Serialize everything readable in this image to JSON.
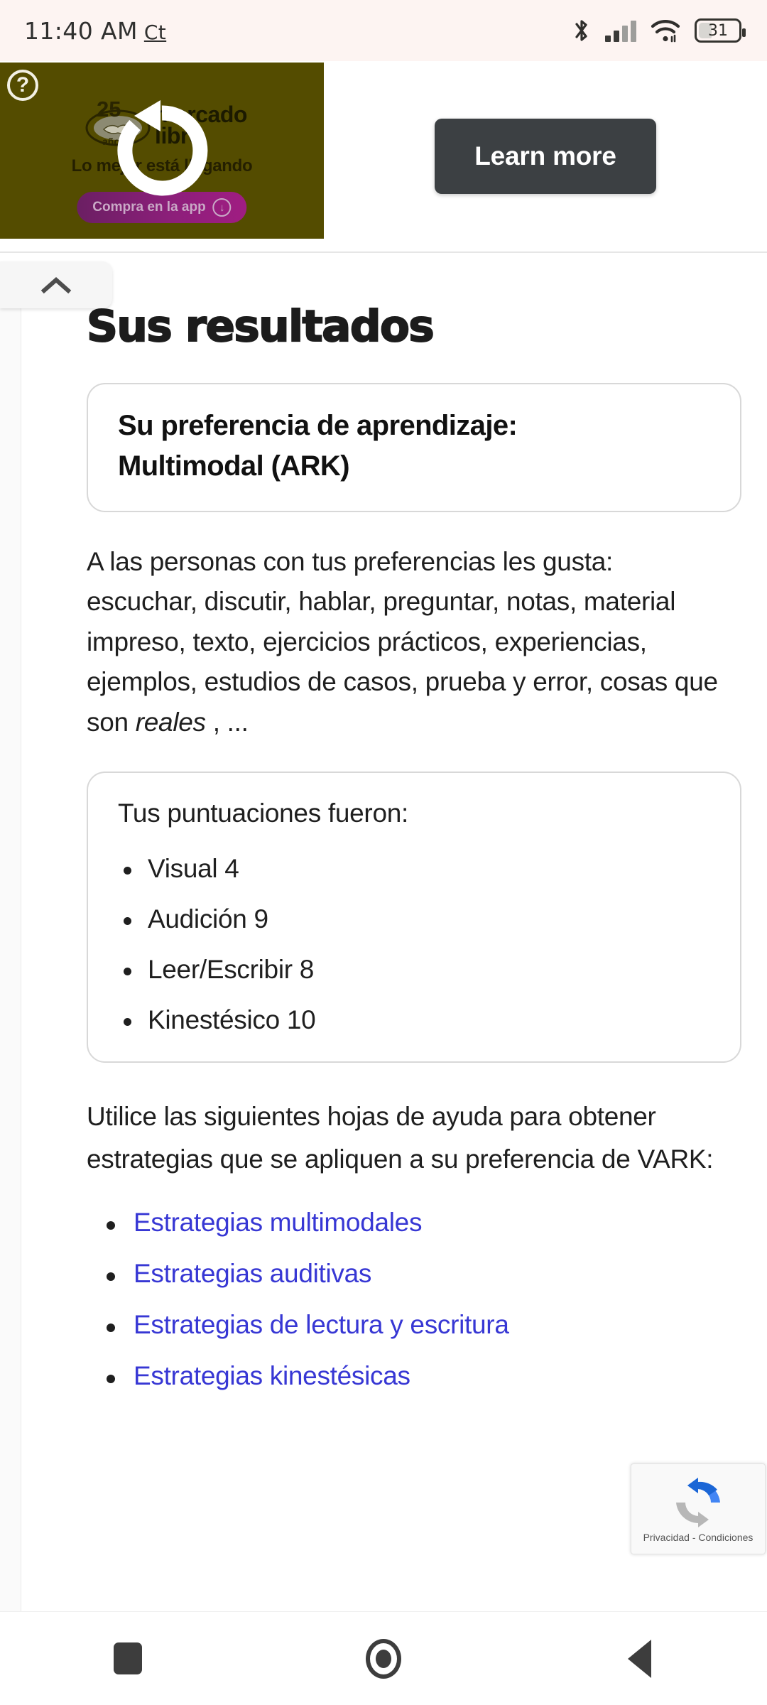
{
  "status_bar": {
    "time": "11:40 AM",
    "timezone": "Ct",
    "battery_percent": "31",
    "icons": [
      "bluetooth-icon",
      "cellular-signal-icon",
      "wifi-icon",
      "battery-icon"
    ]
  },
  "ad": {
    "info_badge": "?",
    "anniversary": "25",
    "anniversary_sub": "años",
    "brand_line1": "mercado",
    "brand_line2": "libre",
    "tagline": "Lo mejor está llegando",
    "cta_label": "Compra en la app",
    "learn_more_label": "Learn more",
    "replay_icon": "replay-icon",
    "background_color": "#544c00",
    "cta_color": "#8c1f7a",
    "learn_more_color": "#3c4043"
  },
  "collapse_tab": {
    "icon": "chevron-up-icon"
  },
  "page": {
    "title": "Sus resultados",
    "preference_card": {
      "label": "Su preferencia de aprendizaje:",
      "value": "Multimodal (ARK)"
    },
    "intro_lead": "A las personas con tus preferencias les gusta:",
    "intro_list": "escuchar, discutir, hablar, preguntar, notas, material impreso, texto, ejercicios prácticos, experiencias, ejemplos, estudios de casos, prueba y error, cosas que son ",
    "intro_emphasis": "reales",
    "intro_tail": " , ...",
    "scores_heading": "Tus puntuaciones fueron:",
    "scores": [
      {
        "label": "Visual",
        "value": "4",
        "text": "Visual 4"
      },
      {
        "label": "Audición",
        "value": "9",
        "text": "Audición 9"
      },
      {
        "label": "Leer/Escribir",
        "value": "8",
        "text": "Leer/Escribir 8"
      },
      {
        "label": "Kinestésico",
        "value": "10",
        "text": "Kinestésico 10"
      }
    ],
    "helpsheets_lead": "Utilice las siguientes hojas de ayuda para obtener estrategias que se apliquen a su preferencia de VARK:",
    "links": [
      {
        "label": "Estrategias multimodales"
      },
      {
        "label": "Estrategias auditivas"
      },
      {
        "label": "Estrategias de lectura y escritura"
      },
      {
        "label": "Estrategias kinestésicas"
      }
    ],
    "link_color": "#3737d4"
  },
  "recaptcha": {
    "privacy_label": "Privacidad",
    "separator": "-",
    "terms_label": "Condiciones",
    "full_text": "Privacidad - Condiciones",
    "icon": "recaptcha-icon"
  },
  "nav_bar": {
    "recents_label": "recents-button",
    "home_label": "home-button",
    "back_label": "back-button"
  }
}
